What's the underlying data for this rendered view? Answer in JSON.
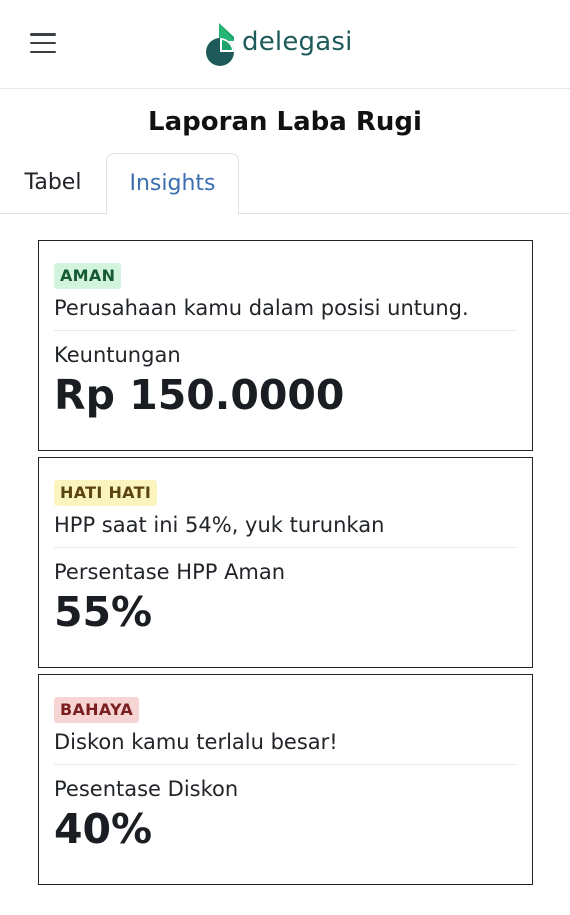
{
  "header": {
    "brand_name": "delegasi",
    "menu_icon": "hamburger-menu-icon",
    "logo_icon": "delegasi-logo-icon",
    "brand_colors": {
      "dark": "#1f5a5a",
      "green": "#1fa36a"
    }
  },
  "page": {
    "title": "Laporan Laba Rugi"
  },
  "tabs": [
    {
      "label": "Tabel",
      "active": false
    },
    {
      "label": "Insights",
      "active": true
    }
  ],
  "insights": [
    {
      "status": "AMAN",
      "status_color": "#d2f4de",
      "message": "Perusahaan kamu dalam posisi untung.",
      "label": "Keuntungan",
      "value": "Rp 150.0000"
    },
    {
      "status": "HATI HATI",
      "status_color": "#fcf4be",
      "message": "HPP saat ini 54%, yuk turunkan",
      "label": "Persentase HPP Aman",
      "value": "55%"
    },
    {
      "status": "BAHAYA",
      "status_color": "#f8d5d5",
      "message": "Diskon kamu terlalu besar!",
      "label": "Pesentase Diskon",
      "value": "40%"
    }
  ]
}
